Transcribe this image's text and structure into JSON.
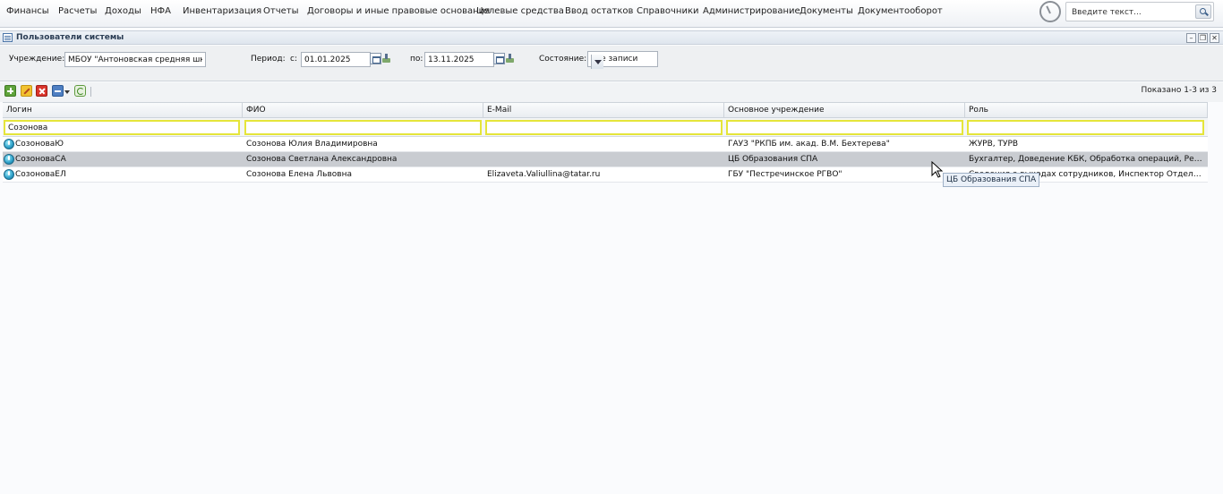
{
  "menu": {
    "items": [
      "Финансы",
      "Расчеты",
      "Доходы",
      "НФА",
      "Инвентаризация",
      "Отчеты",
      "Договоры и иные правовые основания",
      "Целевые средства",
      "Ввод остатков",
      "Справочники",
      "Администрирование",
      "Документы",
      "Документооборот"
    ],
    "search_placeholder": "Введите текст..."
  },
  "window": {
    "title": "Пользователи системы"
  },
  "filters": {
    "institution_label": "Учреждение:",
    "institution_value": "МБОУ \"Антоновская средняя школ",
    "period_label": "Период:",
    "from_label": "с:",
    "from_value": "01.01.2025",
    "to_label": "по:",
    "to_value": "13.11.2025",
    "state_label": "Состояние:",
    "state_value": "Все записи"
  },
  "toolbar": {
    "shown_text": "Показано 1-3 из 3"
  },
  "grid": {
    "columns": [
      "Логин",
      "ФИО",
      "E-Mail",
      "Основное учреждение",
      "Роль"
    ],
    "filter_values": [
      "Созонова",
      "",
      "",
      "",
      ""
    ],
    "rows": [
      {
        "login": "СозоноваЮ",
        "fio": "Созонова Юлия Владимировна",
        "email": "",
        "institution": "ГАУЗ \"РКПБ им. акад. В.М. Бехтерева\"",
        "role": "ЖУРВ, ТУРВ"
      },
      {
        "login": "СозоноваСА",
        "fio": "Созонова Светлана Александровна",
        "email": "",
        "institution": "ЦБ Образования СПА",
        "role": "Бухгалтер, Доведение КБК, Обработка операций, Реестр банковских документов"
      },
      {
        "login": "СозоноваЕЛ",
        "fio": "Созонова Елена Львовна",
        "email": "Elizaveta.Valiullina@tatar.ru",
        "institution": "ГБУ \"Пестречинское РГВО\"",
        "role": "Сведения о выходах сотрудников, Инспектор Отдела Кадров"
      }
    ]
  },
  "tooltip": {
    "text": "ЦБ Образования СПА"
  }
}
